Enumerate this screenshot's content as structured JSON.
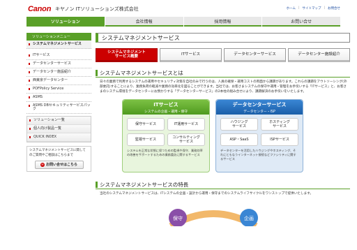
{
  "header": {
    "logo": "Canon",
    "company": "キヤノン ITソリューションズ株式会社",
    "util_links": [
      "ホーム",
      "サイトマップ",
      "お問合せ"
    ]
  },
  "topnav": [
    {
      "label": "ソリューション",
      "active": true
    },
    {
      "label": "会社情報",
      "active": false
    },
    {
      "label": "採用情報",
      "active": false
    },
    {
      "label": "お問い合せ",
      "active": false
    }
  ],
  "sidebar": {
    "head": "ソリューションメニュー",
    "items": [
      "システムマネジメントサービス",
      "ITサービス",
      "データセンターサービス",
      "データセンター施設紹介",
      "西東京データセンター",
      "POFPolicy Service",
      "ASMS",
      "ASMS DBセキュリティサービスパック"
    ],
    "group": [
      "ソリューション一覧",
      "個人向け製品一覧",
      "QUICK INDEX"
    ],
    "box_text": "システムマネジメントサービスに関してのご質問やご相談はこちらまで",
    "contact_label": "お問い合せはこちら"
  },
  "main": {
    "page_title": "システムマネジメントサービス",
    "tabs": [
      {
        "label": "システムマネジメント\nサービス概要",
        "active": true
      },
      {
        "label": "ITサービス",
        "active": false
      },
      {
        "label": "データセンターサービス",
        "active": false
      },
      {
        "label": "データセンター施設紹介",
        "active": false
      }
    ],
    "section1": {
      "title": "システムマネジメントサービスとは",
      "body": "日々の業務で利用するシステムの運用やセキュリティ対策を自社のみで行うのは、人員の確保・運用コストの両面から課題があります。これらの課題をアウトソーシング(外部委託)することにより、業務負荷の軽減や業務の効率化を図ることができます。当社では、お客さまシステムの保守や運用・管理をお手伝いする「ITサービス」と、お客さまのシステム環境をデータセンターにお預かりする「データセンターサービス」の2本柱の組み合せにより、課題解決のお手伝いをいたします。"
    },
    "diagram": {
      "it": {
        "title": "ITサービス",
        "subtitle": "システムの企画・運用・保守",
        "boxes": [
          "保守サービス",
          "IT運用サービス",
          "監視サービス",
          "コンサルティング\nサービス"
        ],
        "desc": "システムを正常な状態に保つための監視や保守、業務効率の改善をサポートするための業務委託に関するサービス"
      },
      "dc": {
        "title": "データセンターサービス",
        "subtitle": "データセンター・ISP",
        "boxes": [
          "ハウジング\nサービス",
          "ホスティング\nサービス",
          "ASP・SaaS",
          "ISPサービス"
        ],
        "desc": "データセンターを活用したハウジングやホスティング、それにともなうインターネット接続などファシリティに関するサービス"
      }
    },
    "section2": {
      "title": "システムマネジメントサービスの特長",
      "body": "当社のシステムマネジメントサービスは、ITシステムの企画・設計から運用・保守までのシステムライフサイクルをワンストップで提供いたします。",
      "cycle_labels": [
        "保守",
        "企画"
      ]
    }
  },
  "colors": {
    "accent_green": "#5aa028",
    "brand_red": "#cc0000",
    "blue": "#1a5ea8"
  }
}
